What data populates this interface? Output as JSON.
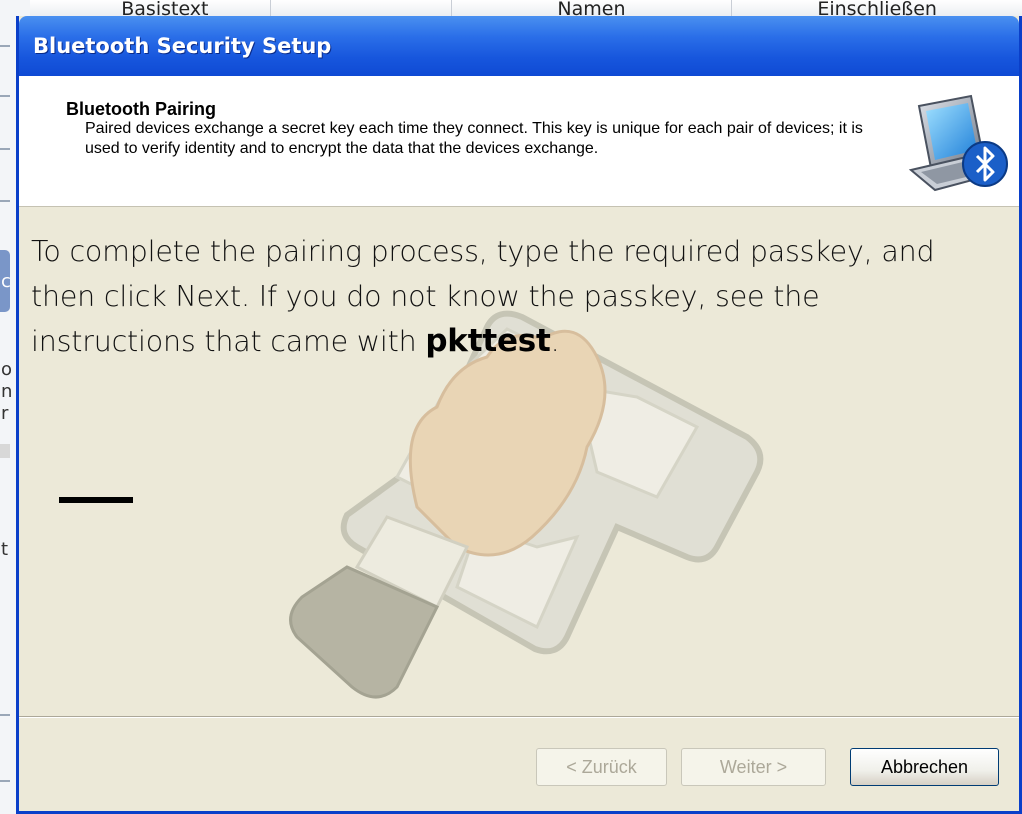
{
  "background_app": {
    "columns": [
      "Basistext",
      "",
      "Namen",
      "Einschließen"
    ],
    "edge_chars": [
      "c",
      "o",
      "n",
      "r",
      "t"
    ]
  },
  "window": {
    "title": "Bluetooth Security Setup"
  },
  "header": {
    "heading": "Bluetooth Pairing",
    "description": "Paired devices exchange a secret key each time they connect. This key is unique for each pair of devices; it is used to verify identity and to encrypt the data that the devices exchange.",
    "icon": "computer-bluetooth-icon"
  },
  "content": {
    "instruction_text": "To complete the pairing process, type the required passkey, and then click Next. If you do not know the passkey, see the instructions that came with ",
    "device_name": "pkttest",
    "instruction_end": ".",
    "passkey_value": "",
    "watermark_icon": "hand-keyboard-icon"
  },
  "buttons": {
    "back": "< Zurück",
    "next": "Weiter >",
    "cancel": "Abbrechen"
  },
  "colors": {
    "titlebar": "#0f4ad4",
    "dialog_bg": "#ece9d8"
  }
}
